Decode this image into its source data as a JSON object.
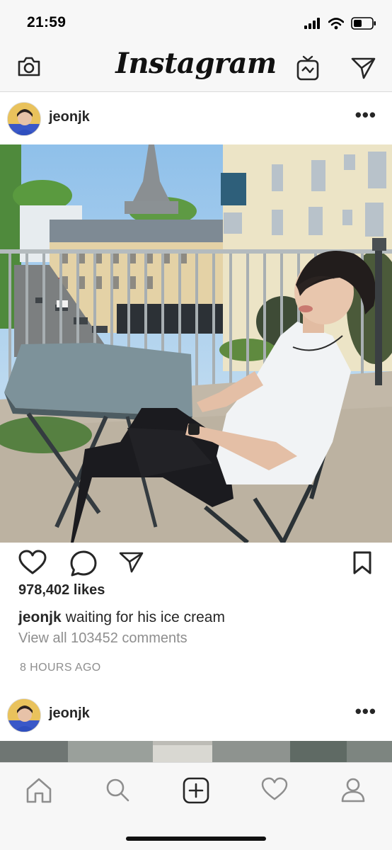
{
  "status_bar": {
    "time": "21:59"
  },
  "top_bar": {
    "logo": "Instagram",
    "icons": [
      "camera-icon",
      "igtv-icon",
      "direct-message-icon"
    ]
  },
  "posts": [
    {
      "username": "jeonjk",
      "more": "•••",
      "likes": "978,402 likes",
      "caption_user": "jeonjk",
      "caption_text": "waiting for his ice cream",
      "view_comments": "View all 103452 comments",
      "timestamp": "8 HOURS AGO"
    },
    {
      "username": "jeonjk",
      "more": "•••"
    }
  ],
  "tab_bar": {
    "icons": [
      "home-icon",
      "search-icon",
      "new-post-icon",
      "activity-icon",
      "profile-icon"
    ]
  },
  "colors": {
    "text": "#262626",
    "secondary_text": "#8e8e8e",
    "bar_background": "#f7f7f7",
    "divider": "#dbdbdb"
  }
}
